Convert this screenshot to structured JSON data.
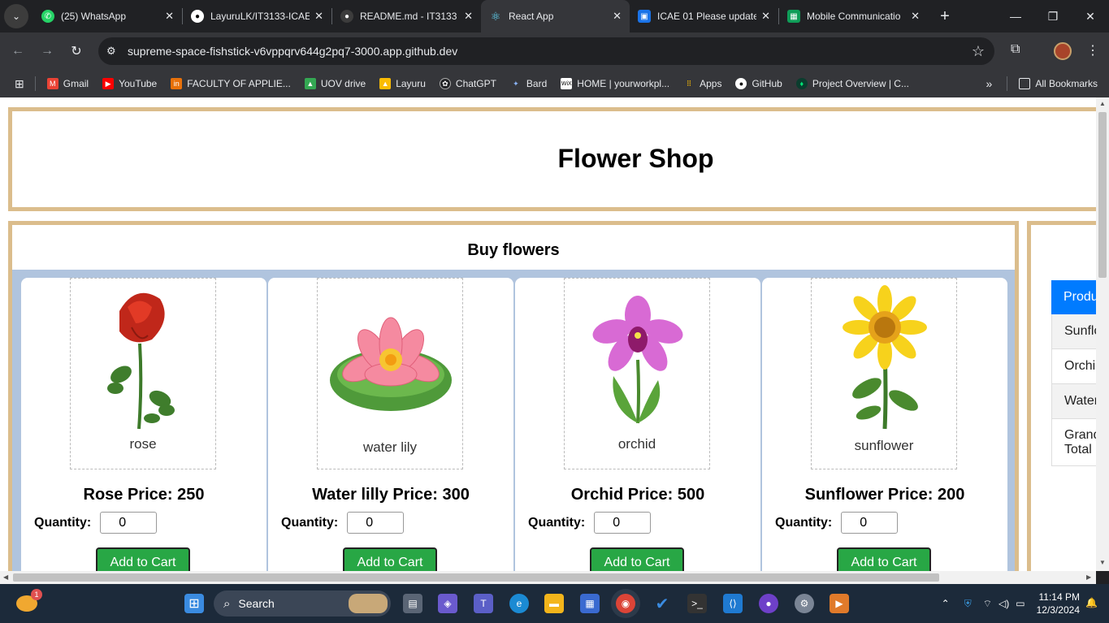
{
  "browser": {
    "tabs": [
      {
        "title": "(25) WhatsApp",
        "icon": "whatsapp-icon",
        "color": "#25d366"
      },
      {
        "title": "LayuruLK/IT3133-ICAE",
        "icon": "github-icon",
        "color": "#ffffff"
      },
      {
        "title": "README.md - IT3133",
        "icon": "github-icon",
        "color": "#5f6368"
      },
      {
        "title": "React App",
        "icon": "react-icon",
        "color": "#61dafb"
      },
      {
        "title": "ICAE 01 Please update",
        "icon": "classroom-icon",
        "color": "#1a73e8"
      },
      {
        "title": "Mobile Communicatio",
        "icon": "sheets-icon",
        "color": "#0f9d58"
      }
    ],
    "url": "supreme-space-fishstick-v6vppqrv644g2pq7-3000.app.github.dev",
    "bookmarks": [
      "Gmail",
      "YouTube",
      "FACULTY OF APPLIE...",
      "UOV drive",
      "Layuru",
      "ChatGPT",
      "Bard",
      "HOME | yourworkpl...",
      "Apps",
      "GitHub",
      "Project Overview | C..."
    ],
    "all_bookmarks": "All Bookmarks"
  },
  "page": {
    "title": "Flower Shop",
    "section_title": "Buy flowers",
    "quantity_label": "Quantity:",
    "add_to_cart_label": "Add to Cart",
    "products": [
      {
        "caption": "rose",
        "price_text": "Rose Price: 250",
        "qty": "0"
      },
      {
        "caption": "water lily",
        "price_text": "Water lilly Price: 300",
        "qty": "0"
      },
      {
        "caption": "orchid",
        "price_text": "Orchid Price: 500",
        "qty": "0"
      },
      {
        "caption": "sunflower",
        "price_text": "Sunflower Price: 200",
        "qty": "0"
      }
    ],
    "cart": {
      "header": "Product",
      "rows": [
        "Sunflower",
        "Orchid",
        "Water lilly"
      ],
      "total_label": "Grand Total"
    }
  },
  "taskbar": {
    "search_placeholder": "Search",
    "time": "11:14 PM",
    "date": "12/3/2024",
    "weather_badge": "1"
  },
  "colors": {
    "accent_border": "#dbbd8c",
    "grid_bg": "#b0c4de",
    "button_green": "#28a745",
    "cart_header": "#007bff"
  }
}
